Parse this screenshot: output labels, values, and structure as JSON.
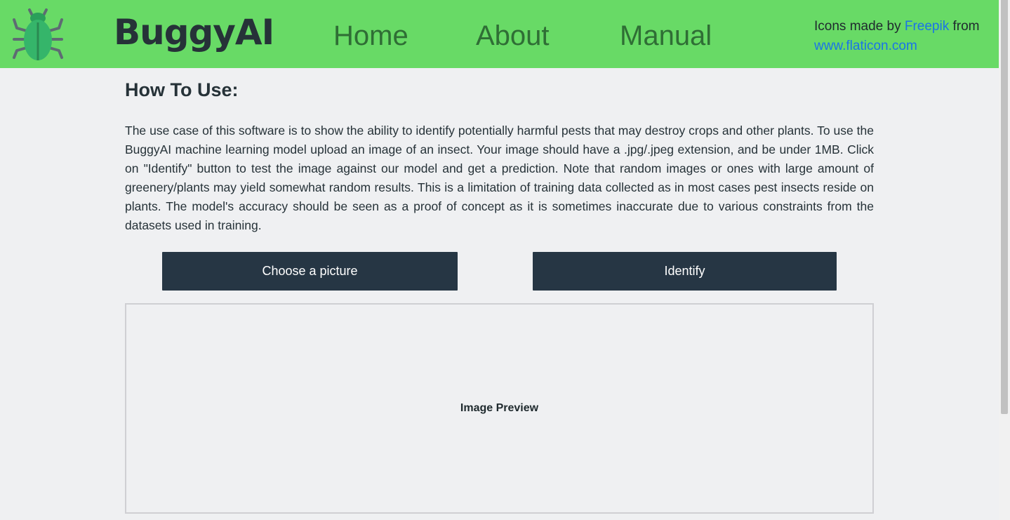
{
  "brand": {
    "name": "BuggyAI",
    "logo_icon": "beetle-icon"
  },
  "nav": {
    "items": [
      {
        "label": "Home"
      },
      {
        "label": "About"
      },
      {
        "label": "Manual"
      }
    ]
  },
  "credits": {
    "prefix": "Icons made by ",
    "author": "Freepik",
    "middle": " from",
    "site": "www.flaticon.com"
  },
  "main": {
    "heading": "How To Use:",
    "description": "The use case of this software is to show the ability to identify potentially harmful pests that may destroy crops and other plants. To use the BuggyAI machine learning model upload an image of an insect. Your image should have a .jpg/.jpeg extension, and be under 1MB. Click on \"Identify\" button to test the image against our model and get a prediction. Note that random images or ones with large amount of greenery/plants may yield somewhat random results. This is a limitation of training data collected as in most cases pest insects reside on plants. The model's accuracy should be seen as a proof of concept as it is sometimes inaccurate due to various constraints from the datasets used in training.",
    "choose_button": "Choose a picture",
    "identify_button": "Identify",
    "preview_label": "Image Preview"
  },
  "colors": {
    "navbar": "#68da66",
    "brand_text": "#263238",
    "nav_link": "#2f6e35",
    "link": "#1a73e8",
    "button_bg": "#263644",
    "page_bg": "#eff0f2"
  }
}
